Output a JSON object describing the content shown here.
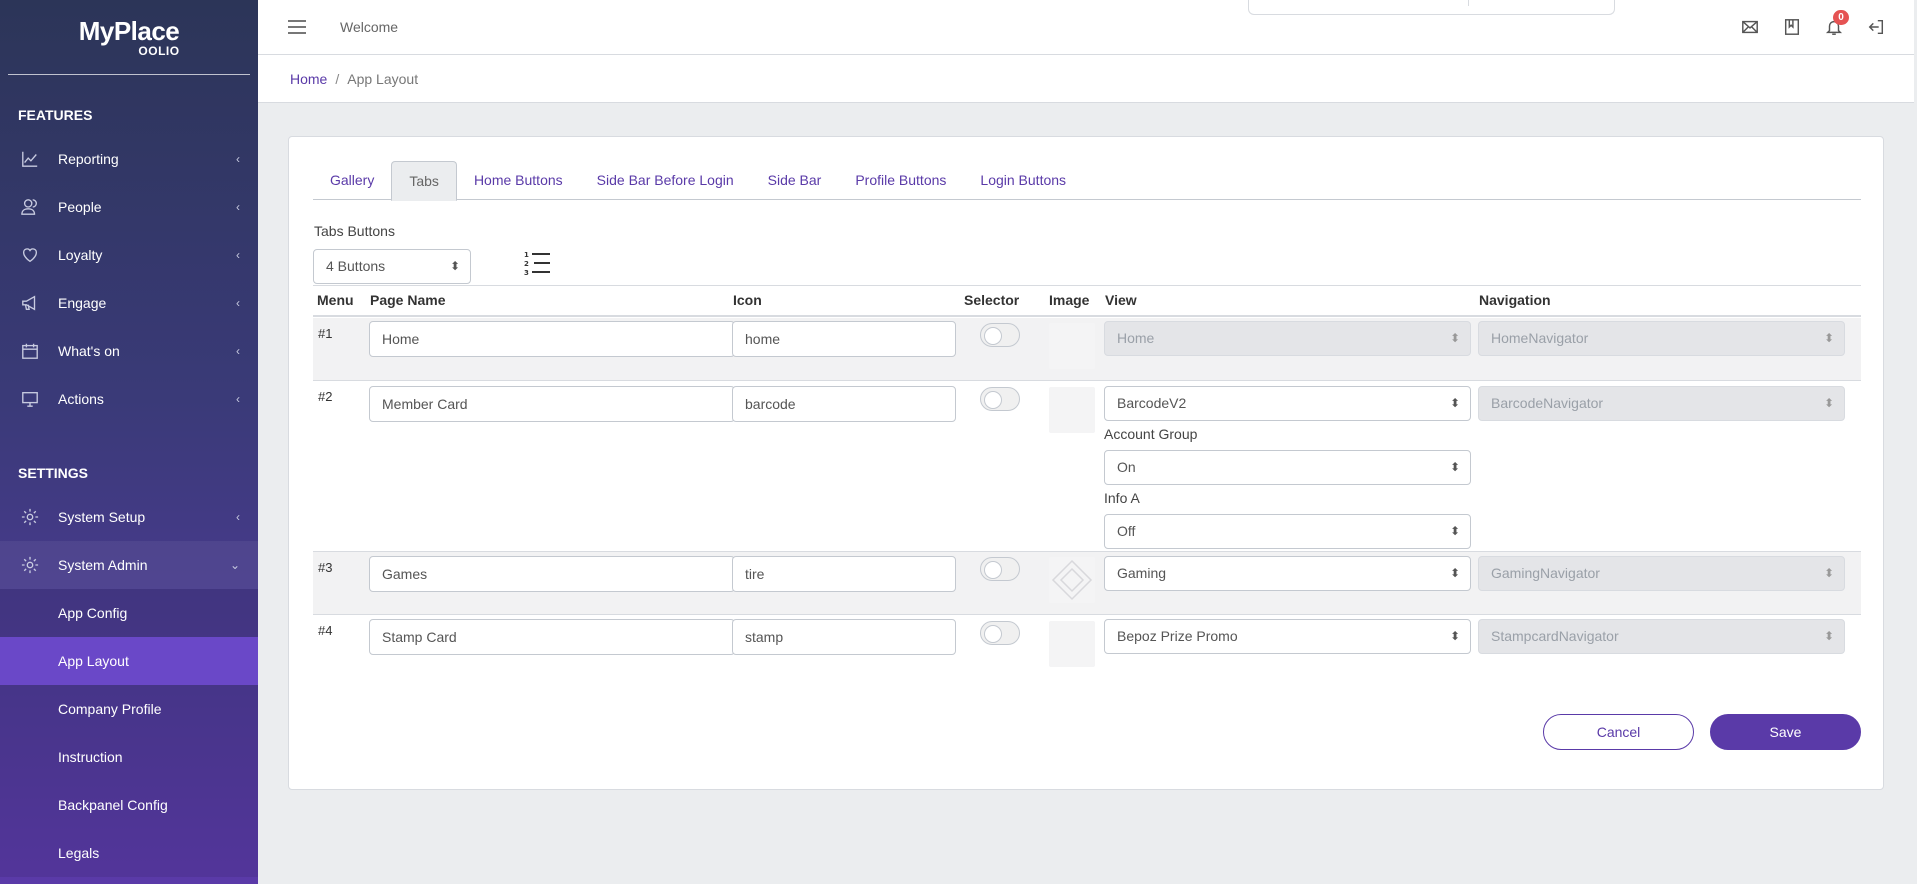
{
  "brand": {
    "name": "MyPlace",
    "sub": "OOLIO"
  },
  "sidebar": {
    "features_title": "FEATURES",
    "features": [
      {
        "label": "Reporting",
        "icon": "chart-line-icon"
      },
      {
        "label": "People",
        "icon": "people-icon"
      },
      {
        "label": "Loyalty",
        "icon": "heart-icon"
      },
      {
        "label": "Engage",
        "icon": "megaphone-icon"
      },
      {
        "label": "What's on",
        "icon": "calendar-icon"
      },
      {
        "label": "Actions",
        "icon": "monitor-icon"
      }
    ],
    "settings_title": "SETTINGS",
    "settings": [
      {
        "label": "System Setup",
        "icon": "gear-icon"
      },
      {
        "label": "System Admin",
        "icon": "gear-icon"
      }
    ],
    "admin_sub": [
      "App Config",
      "App Layout",
      "Company Profile",
      "Instruction",
      "Backpanel Config",
      "Legals"
    ],
    "active_sub": "App Layout"
  },
  "header": {
    "welcome": "Welcome",
    "notification_count": "0",
    "icons": [
      "mail-icon",
      "book-icon",
      "bell-icon",
      "logout-icon"
    ]
  },
  "breadcrumb": {
    "home": "Home",
    "separator": "/",
    "current": "App Layout"
  },
  "tabs": [
    "Gallery",
    "Tabs",
    "Home Buttons",
    "Side Bar Before Login",
    "Side Bar",
    "Profile Buttons",
    "Login Buttons"
  ],
  "active_tab": "Tabs",
  "tabs_buttons": {
    "label": "Tabs Buttons",
    "selected": "4 Buttons"
  },
  "table": {
    "headers": [
      "Menu",
      "Page Name",
      "Icon",
      "Selector",
      "Image",
      "View",
      "Navigation"
    ],
    "rows": [
      {
        "num": "#1",
        "page_name": "Home",
        "icon": "home",
        "view": "Home",
        "navigation": "HomeNavigator"
      },
      {
        "num": "#2",
        "page_name": "Member Card",
        "icon": "barcode",
        "view": "BarcodeV2",
        "navigation": "BarcodeNavigator",
        "account_group_label": "Account Group",
        "account_group": "On",
        "info_a_label": "Info A",
        "info_a": "Off"
      },
      {
        "num": "#3",
        "page_name": "Games",
        "icon": "tire",
        "view": "Gaming",
        "navigation": "GamingNavigator"
      },
      {
        "num": "#4",
        "page_name": "Stamp Card",
        "icon": "stamp",
        "view": "Bepoz Prize Promo",
        "navigation": "StampcardNavigator"
      }
    ]
  },
  "actions": {
    "cancel": "Cancel",
    "save": "Save"
  }
}
